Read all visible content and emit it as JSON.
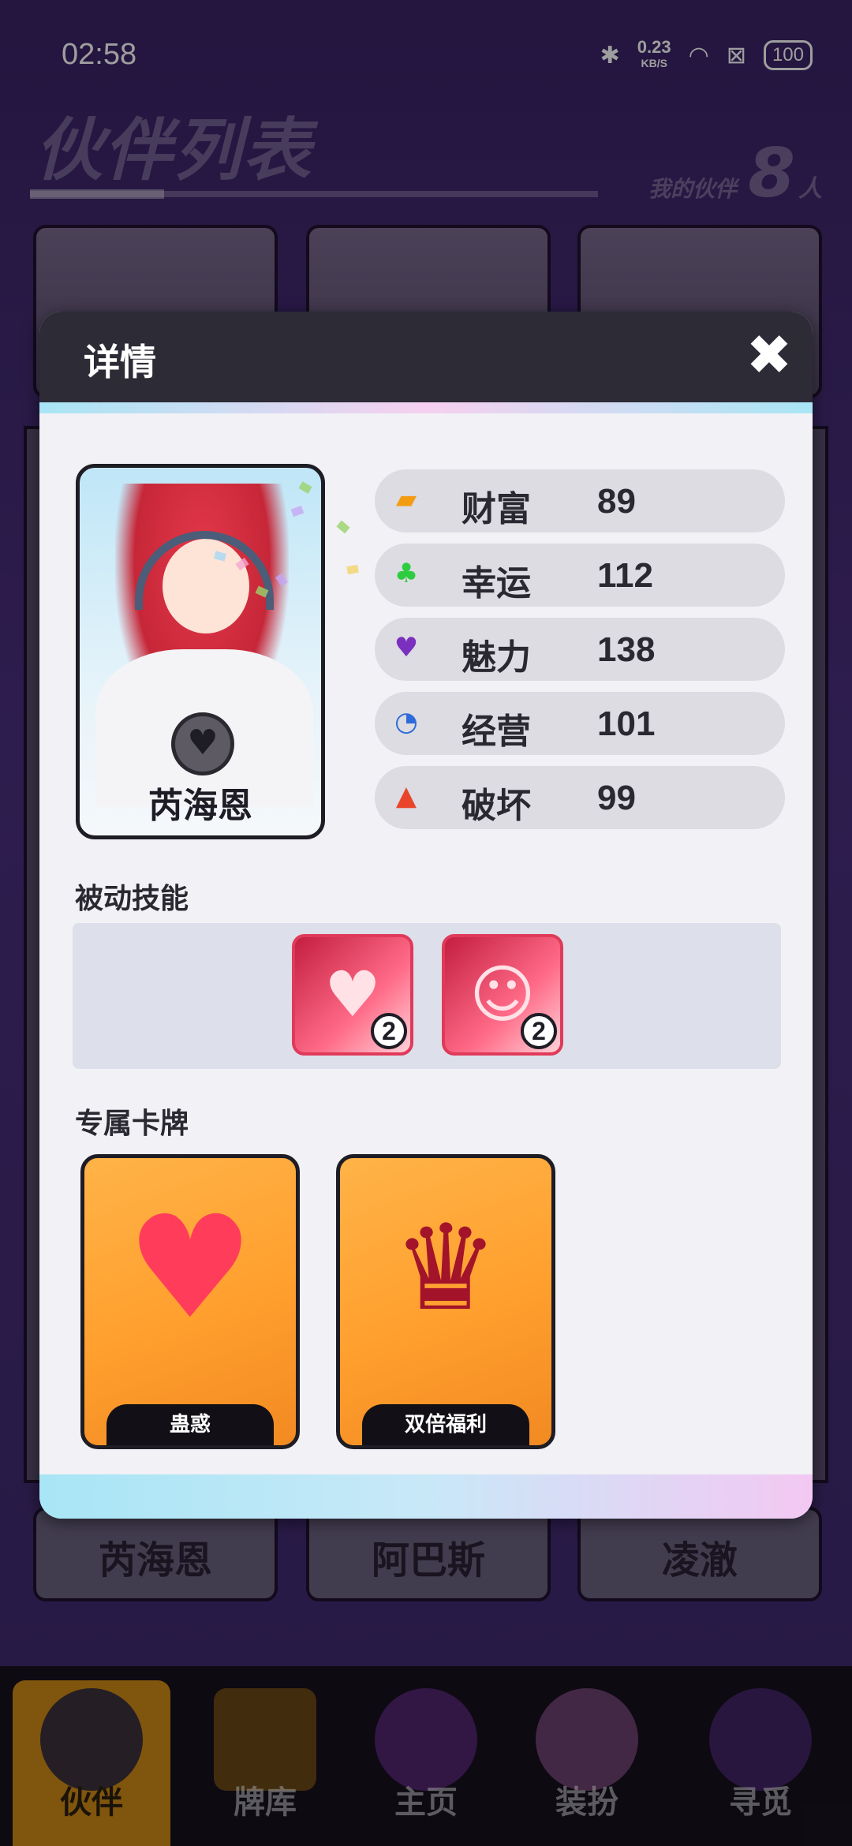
{
  "status_bar": {
    "time": "02:58",
    "net_speed": "0.23",
    "net_unit": "KB/S",
    "battery": "100"
  },
  "page": {
    "title": "伙伴列表",
    "my_partner_label": "我的伙伴",
    "my_partner_count": "8",
    "my_partner_unit": "人"
  },
  "background_cards": {
    "names": [
      "芮海恩",
      "阿巴斯",
      "凌澈"
    ]
  },
  "modal": {
    "title": "详情",
    "close_icon": "close-icon",
    "partner_name": "芮海恩",
    "stats": [
      {
        "icon": "ticket-icon",
        "label": "财富",
        "value": "89",
        "color": "#f39c12"
      },
      {
        "icon": "clover-icon",
        "label": "幸运",
        "value": "112",
        "color": "#2ecc40"
      },
      {
        "icon": "heart-mask-icon",
        "label": "魅力",
        "value": "138",
        "color": "#7b2fbf"
      },
      {
        "icon": "pie-chart-icon",
        "label": "经营",
        "value": "101",
        "color": "#2f6bd8"
      },
      {
        "icon": "flame-icon",
        "label": "破坏",
        "value": "99",
        "color": "#e8452a"
      }
    ],
    "passive_skills_title": "被动技能",
    "passive_skills": [
      {
        "icon": "heart-arrows-icon",
        "level": "2"
      },
      {
        "icon": "character-skill-icon",
        "level": "2"
      }
    ],
    "exclusive_cards_title": "专属卡牌",
    "exclusive_cards": [
      {
        "name": "蛊惑",
        "icon": "heart-hand-icon"
      },
      {
        "name": "双倍福利",
        "icon": "throne-character-icon"
      }
    ]
  },
  "bottom_nav": [
    {
      "label": "伙伴",
      "icon": "partner-avatar-icon",
      "active": true
    },
    {
      "label": "牌库",
      "icon": "card-deck-icon",
      "active": false
    },
    {
      "label": "主页",
      "icon": "home-emblem-icon",
      "active": false
    },
    {
      "label": "装扮",
      "icon": "hanger-icon",
      "active": false
    },
    {
      "label": "寻觅",
      "icon": "star-orb-icon",
      "active": false
    }
  ],
  "colors": {
    "accent_orange": "#cf8a15",
    "modal_header": "#2d2b36",
    "skill_border": "#e03a5a"
  }
}
